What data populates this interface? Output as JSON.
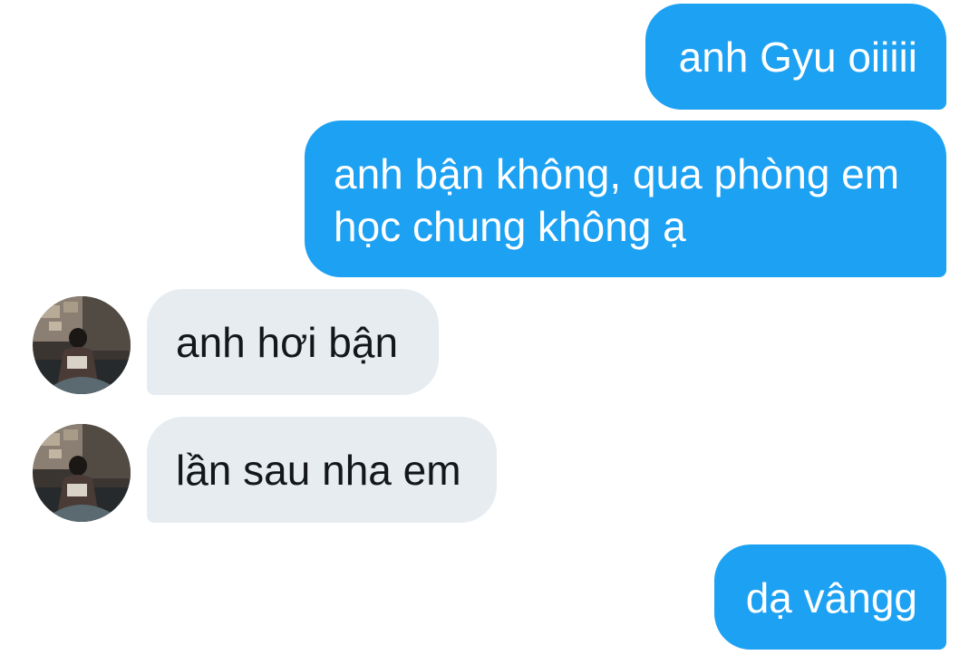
{
  "messages": [
    {
      "from": "me",
      "text": "anh Gyu oiiiii"
    },
    {
      "from": "me",
      "text": "anh bận không, qua phòng em\nhọc chung không ạ"
    },
    {
      "from": "other",
      "text": "anh hơi bận"
    },
    {
      "from": "other",
      "text": "lần sau nha em"
    },
    {
      "from": "me",
      "text": "dạ vângg"
    }
  ],
  "colors": {
    "sent_bubble": "#1da1f2",
    "received_bubble": "#e6ecf0",
    "sent_text": "#ffffff",
    "received_text": "#14171a",
    "background": "#ffffff"
  }
}
